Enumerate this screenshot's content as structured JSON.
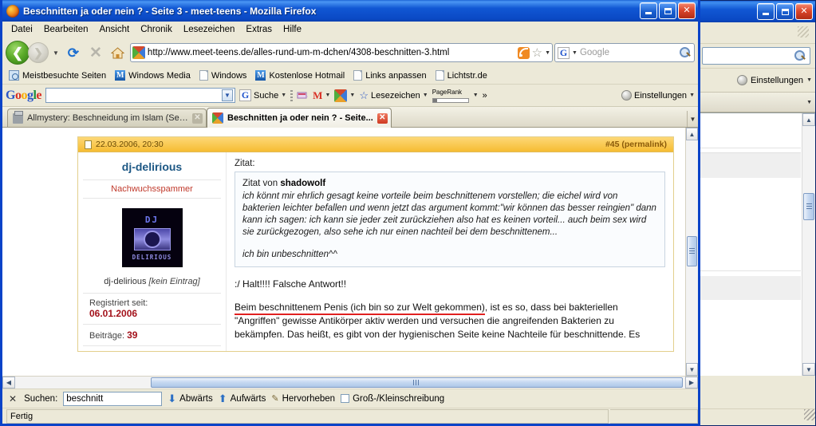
{
  "window": {
    "title": "Beschnitten ja oder nein ? - Seite 3 - meet-teens - Mozilla Firefox",
    "minimize_label": "Minimieren",
    "maximize_label": "Maximieren",
    "close_label": "Schließen"
  },
  "menu": {
    "items": [
      "Datei",
      "Bearbeiten",
      "Ansicht",
      "Chronik",
      "Lesezeichen",
      "Extras",
      "Hilfe"
    ]
  },
  "nav": {
    "back_label": "❮",
    "forward_label": "❯",
    "dropdown_label": "▼",
    "reload_label": "⟳",
    "stop_label": "✕",
    "home_label": "⌂",
    "url": "http://www.meet-teens.de/alles-rund-um-m-dchen/4308-beschnitten-3.html",
    "star_label": "☆",
    "rss_label": "RSS",
    "search_engine": "G",
    "search_placeholder": "Google",
    "search_value": ""
  },
  "bookmarks": {
    "items": [
      {
        "label": "Meistbesuchte Seiten",
        "icon": "folder-blue-icon"
      },
      {
        "label": "Windows Media",
        "icon": "m-icon"
      },
      {
        "label": "Windows",
        "icon": "page-icon"
      },
      {
        "label": "Kostenlose Hotmail",
        "icon": "m-icon"
      },
      {
        "label": "Links anpassen",
        "icon": "page-icon"
      },
      {
        "label": "Lichtstr.de",
        "icon": "page-icon"
      }
    ]
  },
  "gtoolbar": {
    "logo": "Google",
    "search_value": "",
    "items": [
      {
        "label": "Suche",
        "icon": "g-icon"
      },
      {
        "label": "",
        "icon": "highlight-icon"
      },
      {
        "label": "",
        "icon": "gmail-icon"
      },
      {
        "label": "",
        "icon": "share-icon"
      },
      {
        "label": "Lesezeichen",
        "icon": "star-icon"
      },
      {
        "label": "PageRank",
        "icon": "pagerank-icon"
      },
      {
        "label": "»",
        "icon": "chevron-right-icon"
      }
    ],
    "settings_label": "Einstellungen",
    "settings_label_2": "Einstellungen",
    "overflow_label": "»"
  },
  "tabs": [
    {
      "label": "Allmystery: Beschneidung im Islam (Seit...",
      "active": false,
      "icon": "printer-icon"
    },
    {
      "label": "Beschnitten ja oder nein ? - Seite...",
      "active": true,
      "icon": "firefox-icon"
    }
  ],
  "tablist_menu_label": "▼",
  "post": {
    "date": "22.03.2006, 20:30",
    "permalink": "#45 (permalink)",
    "user": {
      "name": "dj-delirious",
      "rank": "Nachwuchsspammer",
      "avatar_top": "DJ",
      "avatar_bottom": "DELIRIOUS",
      "title_line": "dj-delirious",
      "title_note": "[kein Eintrag]",
      "registered_label": "Registriert seit:",
      "registered_value": "06.01.2006",
      "posts_label": "Beiträge:",
      "posts_value": "39"
    },
    "quote_label": "Zitat:",
    "quote": {
      "head_prefix": "Zitat von ",
      "head_author": "shadowolf",
      "text": "ich könnt mir ehrlich gesagt keine vorteile beim beschnittenem vorstellen; die eichel wird von bakterien leichter befallen und wenn jetzt das argument kommt:\"wir können das besser reingien\" dann kann ich sagen: ich kann sie jeder zeit zurückziehen also hat es keinen vorteil... auch beim sex wird sie zurückgezogen, also sehe ich nur einen nachteil bei dem beschnittenem...",
      "signature": "ich bin unbeschnitten^^"
    },
    "body_line1": ":/ Halt!!!! Falsche Antwort!!",
    "body_highlight": "Beim beschnittenem Penis (ich bin so zur Welt gekommen)",
    "body_rest": ", ist es so, dass bei bakteriellen \"Angriffen\" gewisse Antikörper aktiv werden und versuchen die angreifenden Bakterien zu bekämpfen. Das heißt, es gibt von der hygienischen Seite keine Nachteile für beschnittende. Es"
  },
  "findbar": {
    "close_label": "✕",
    "label": "Suchen:",
    "value": "beschnitt",
    "placeholder": "",
    "next_label": "Abwärts",
    "prev_label": "Aufwärts",
    "highlight_label": "Hervorheben",
    "matchcase_label": "Groß-/Kleinschreibung"
  },
  "statusbar": {
    "text": "Fertig"
  },
  "bgwindow": {
    "minimize_label": "Minimieren",
    "maximize_label": "Maximieren",
    "close_label": "Schließen",
    "settings_label": "Einstellungen",
    "dropdown_label": "▼"
  },
  "colors": {
    "accent_blue": "#0a43c8",
    "post_header": "#f6bc33",
    "rank_red": "#c0392b",
    "value_red": "#a3121b",
    "highlight_underline": "#e02020",
    "username_blue": "#1c5784"
  }
}
